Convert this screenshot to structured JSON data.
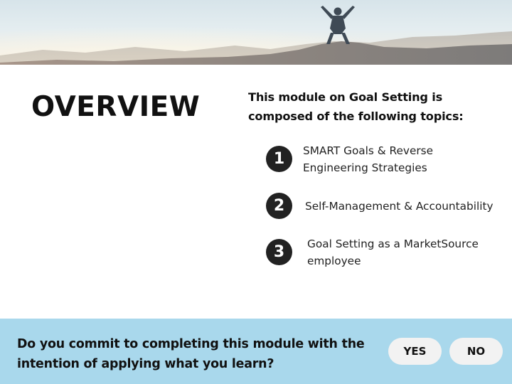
{
  "overview": {
    "title": "OVERVIEW",
    "intro_line1": "This module on Goal Setting is",
    "intro_line2": "composed of the following topics:"
  },
  "topics": [
    {
      "number": "1",
      "line1": "SMART Goals & Reverse",
      "line2": "Engineering Strategies"
    },
    {
      "number": "2",
      "line1": "Self-Management & Accountability"
    },
    {
      "number": "3",
      "line1": "Goal Setting as a MarketSource",
      "line2": "employee"
    }
  ],
  "commitment": {
    "question_line1": "Do you commit to completing this module with the",
    "question_line2": "intention of applying what you learn?",
    "yes_label": "YES",
    "no_label": "NO"
  },
  "colors": {
    "footer_bg": "#a9d8ec",
    "button_bg": "#f2f2f2",
    "number_circle": "#222222"
  },
  "icons": {
    "banner": "mountain-summit-person-photo"
  }
}
